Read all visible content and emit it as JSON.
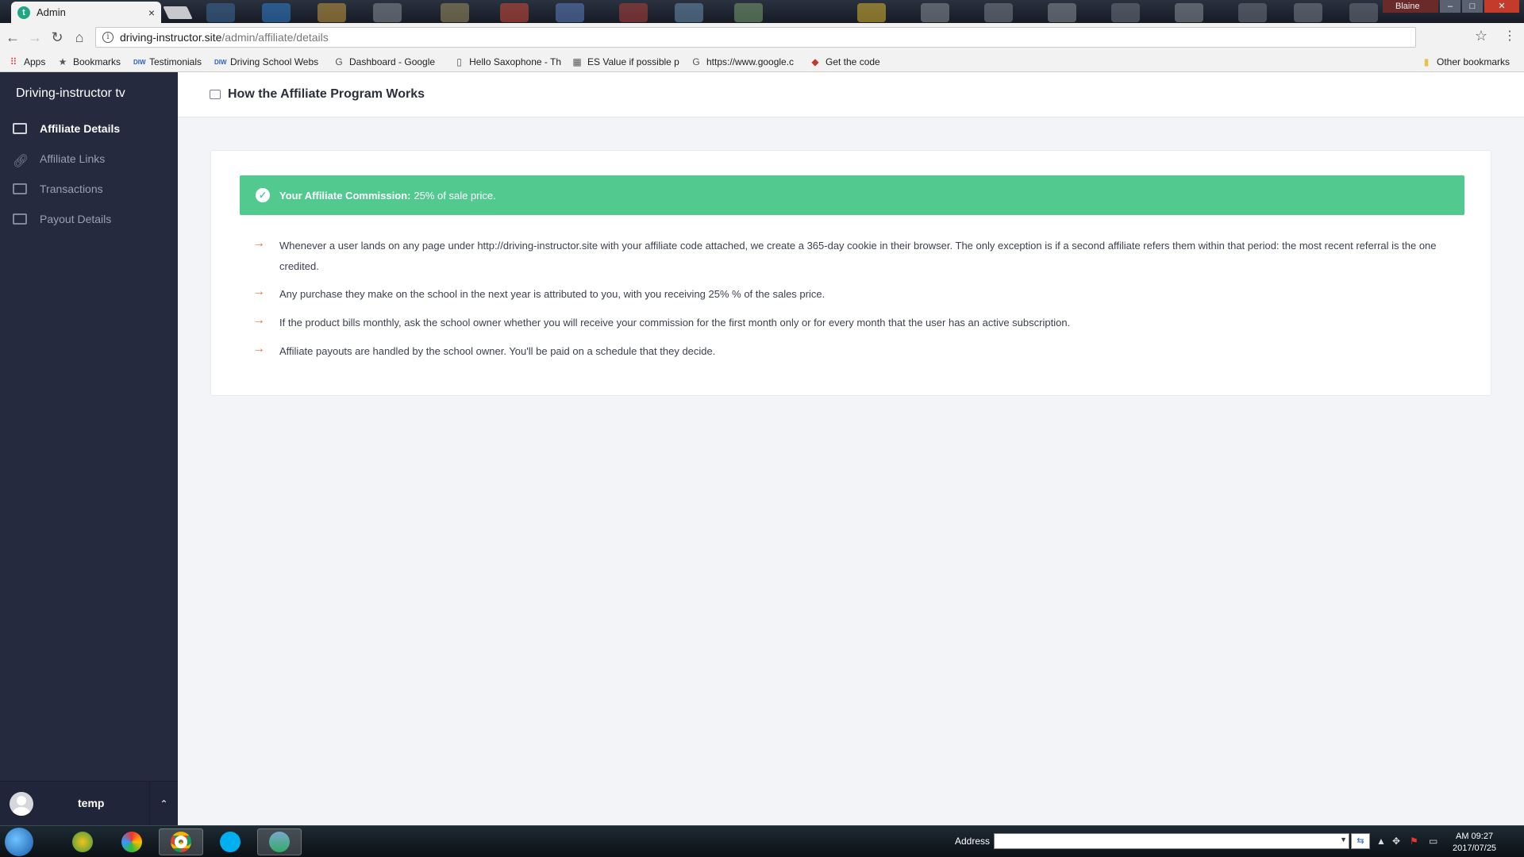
{
  "browser": {
    "tab_title": "Admin",
    "tab_close": "×",
    "url_host": "driving-instructor.site",
    "url_path": "/admin/affiliate/details",
    "window_user": "Blaine",
    "bookmarks": [
      {
        "label": "Apps",
        "icon": "apps-grid-icon"
      },
      {
        "label": "Bookmarks",
        "icon": "star-icon"
      },
      {
        "label": "Testimonials",
        "icon": "site-icon"
      },
      {
        "label": "Driving School Webs",
        "icon": "site-icon"
      },
      {
        "label": "Dashboard - Google",
        "icon": "google-icon"
      },
      {
        "label": "Hello Saxophone - Th",
        "icon": "page-icon"
      },
      {
        "label": "ES Value if possible p",
        "icon": "site-icon"
      },
      {
        "label": "https://www.google.c",
        "icon": "google-icon"
      },
      {
        "label": "Get the code",
        "icon": "code-icon"
      }
    ],
    "other_bookmarks": "Other bookmarks"
  },
  "sidebar": {
    "brand": "Driving-instructor tv",
    "items": [
      {
        "label": "Affiliate Details",
        "active": true
      },
      {
        "label": "Affiliate Links",
        "active": false
      },
      {
        "label": "Transactions",
        "active": false
      },
      {
        "label": "Payout Details",
        "active": false
      }
    ],
    "user": {
      "name": "temp"
    }
  },
  "main": {
    "title": "How the Affiliate Program Works",
    "alert": {
      "strong": "Your Affiliate Commission:",
      "text": "25% of sale price."
    },
    "bullets": [
      "Whenever a user lands on any page under http://driving-instructor.site with your affiliate code attached, we create a 365-day cookie in their browser. The only exception is if a second affiliate refers them within that period: the most recent referral is the one credited.",
      "Any purchase they make on the school in the next year is attributed to you, with you receiving 25% % of the sales price.",
      "If the product bills monthly, ask the school owner whether you will receive your commission for the first month only or for every month that the user has an active subscription.",
      "Affiliate payouts are handled by the school owner. You'll be paid on a schedule that they decide."
    ]
  },
  "taskbar": {
    "address_label": "Address",
    "clock_time": "AM 09:27",
    "clock_date": "2017/07/25"
  },
  "colors": {
    "sidebar_bg": "#252a3f",
    "alert_green": "#52c98f",
    "arrow_orange": "#e8704a"
  }
}
